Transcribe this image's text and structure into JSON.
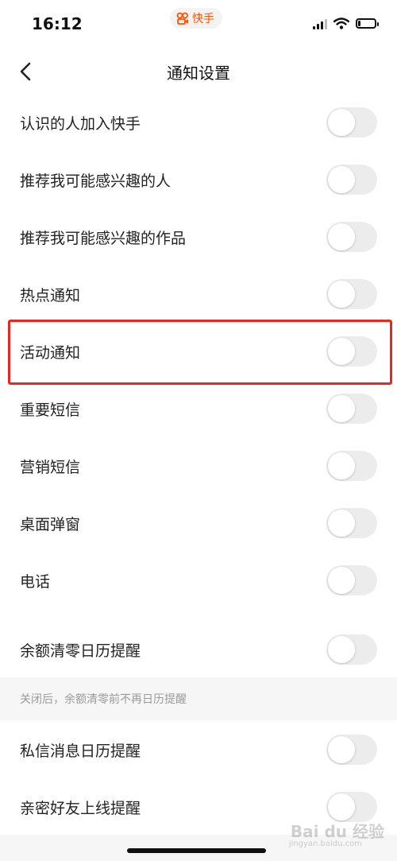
{
  "status_bar": {
    "time": "16:12",
    "app_name": "快手",
    "brand_color": "#ff5000",
    "battery_level": 0.15
  },
  "nav": {
    "title": "通知设置"
  },
  "settings": [
    {
      "label": "认识的人加入快手",
      "enabled": false
    },
    {
      "label": "推荐我可能感兴趣的人",
      "enabled": false
    },
    {
      "label": "推荐我可能感兴趣的作品",
      "enabled": false
    },
    {
      "label": "热点通知",
      "enabled": false
    },
    {
      "label": "活动通知",
      "enabled": false
    },
    {
      "label": "重要短信",
      "enabled": false
    },
    {
      "label": "营销短信",
      "enabled": false
    },
    {
      "label": "桌面弹窗",
      "enabled": false
    },
    {
      "label": "电话",
      "enabled": false
    },
    {
      "label": "余额清零日历提醒",
      "enabled": false
    },
    {
      "label": "私信消息日历提醒",
      "enabled": false
    },
    {
      "label": "亲密好友上线提醒",
      "enabled": false
    }
  ],
  "hint": "关闭后，余额清零前不再日历提醒",
  "highlight_color": "#e8281e",
  "watermark": {
    "text": "Bai du 经验",
    "sub": "jingyan.baidu.com"
  }
}
